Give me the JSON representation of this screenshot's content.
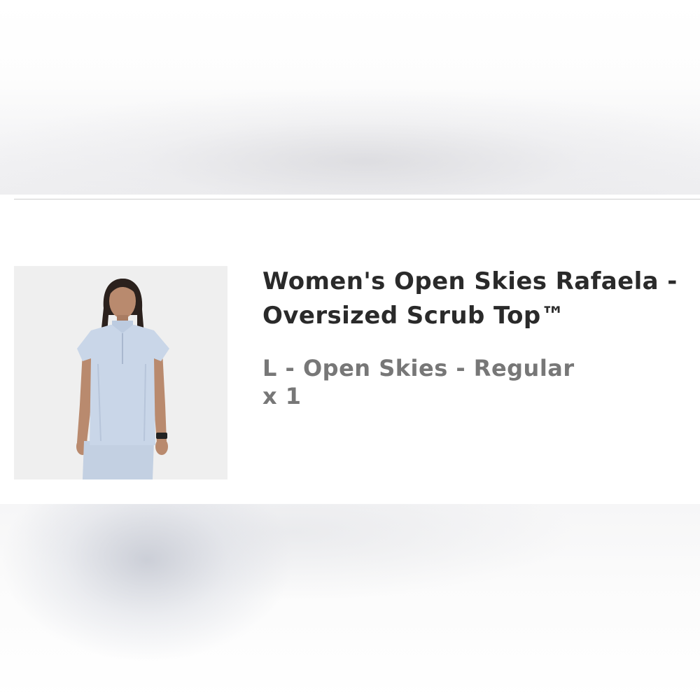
{
  "cart_item": {
    "title": "Women's Open Skies Rafaela -\nOversized Scrub Top™",
    "variant": "L - Open Skies - Regular",
    "quantity": "x 1",
    "image_subject": "product-photo-scrub-top",
    "product_color": "#c9d6e8"
  }
}
